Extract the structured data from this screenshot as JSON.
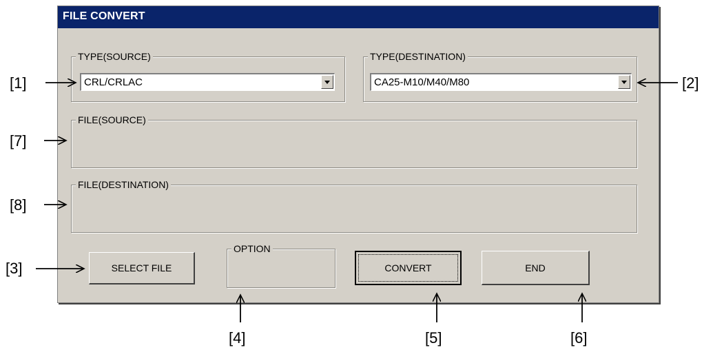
{
  "window": {
    "title": "FILE CONVERT"
  },
  "type_source": {
    "label": "TYPE(SOURCE)",
    "value": "CRL/CRLAC"
  },
  "type_destination": {
    "label": "TYPE(DESTINATION)",
    "value": "CA25-M10/M40/M80"
  },
  "file_source": {
    "label": "FILE(SOURCE)"
  },
  "file_destination": {
    "label": "FILE(DESTINATION)"
  },
  "option": {
    "label": "OPTION"
  },
  "buttons": {
    "select_file": "SELECT FILE",
    "convert": "CONVERT",
    "end": "END"
  },
  "annotations": {
    "a1": "[1]",
    "a2": "[2]",
    "a3": "[3]",
    "a4": "[4]",
    "a5": "[5]",
    "a6": "[6]",
    "a7": "[7]",
    "a8": "[8]"
  }
}
